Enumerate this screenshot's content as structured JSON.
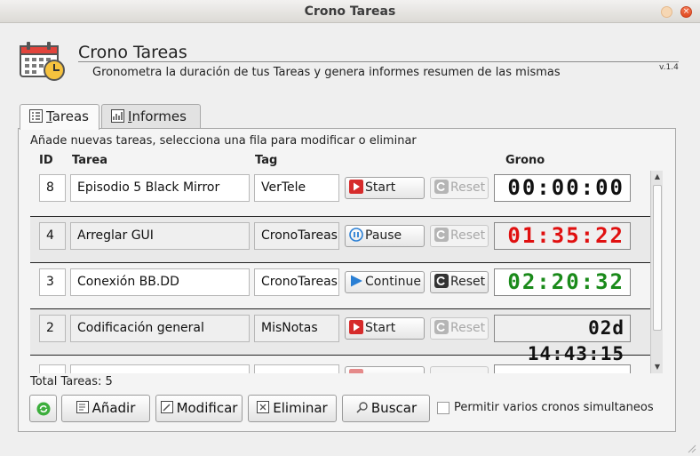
{
  "window": {
    "title": "Crono Tareas"
  },
  "header": {
    "title": "Crono Tareas",
    "subtitle": "Gronometra la duración de tus Tareas y genera informes resumen de las mismas",
    "version": "v.1.4"
  },
  "tabs": [
    {
      "label": "Tareas",
      "mnemonic": "T",
      "rest": "areas",
      "active": true
    },
    {
      "label": "Informes",
      "mnemonic": "I",
      "rest": "nformes",
      "active": false
    }
  ],
  "hint": "Añade nuevas tareas, selecciona una fila para modificar o eliminar",
  "columns": {
    "id": "ID",
    "tarea": "Tarea",
    "tag": "Tag",
    "grono": "Grono"
  },
  "rows": [
    {
      "id": "8",
      "tarea": "Episodio 5 Black Mirror",
      "tag": "VerTele",
      "action": "Start",
      "action_icon": "play-red-icon",
      "reset": "Reset",
      "reset_enabled": false,
      "time": "00:00:00",
      "time_color": "#111111"
    },
    {
      "id": "4",
      "tarea": "Arreglar GUI",
      "tag": "CronoTareas",
      "action": "Pause",
      "action_icon": "pause-blue-icon",
      "reset": "Reset",
      "reset_enabled": false,
      "time": "01:35:22",
      "time_color": "#e01010"
    },
    {
      "id": "3",
      "tarea": "Conexión BB.DD",
      "tag": "CronoTareas",
      "action": "Continue",
      "action_icon": "play-blue-icon",
      "reset": "Reset",
      "reset_enabled": true,
      "time": "02:20:32",
      "time_color": "#1a8a1a"
    },
    {
      "id": "2",
      "tarea": "Codificación general",
      "tag": "MisNotas",
      "action": "Start",
      "action_icon": "play-red-icon",
      "reset": "Reset",
      "reset_enabled": false,
      "time": "02d 14:43:15",
      "time_color": "#111111"
    }
  ],
  "footer": {
    "total": "Total Tareas: 5",
    "buttons": {
      "anadir": "Añadir",
      "modificar": "Modificar",
      "eliminar": "Eliminar",
      "buscar": "Buscar"
    },
    "checkbox_label": "Permitir varios cronos simultaneos",
    "checkbox_checked": false
  }
}
